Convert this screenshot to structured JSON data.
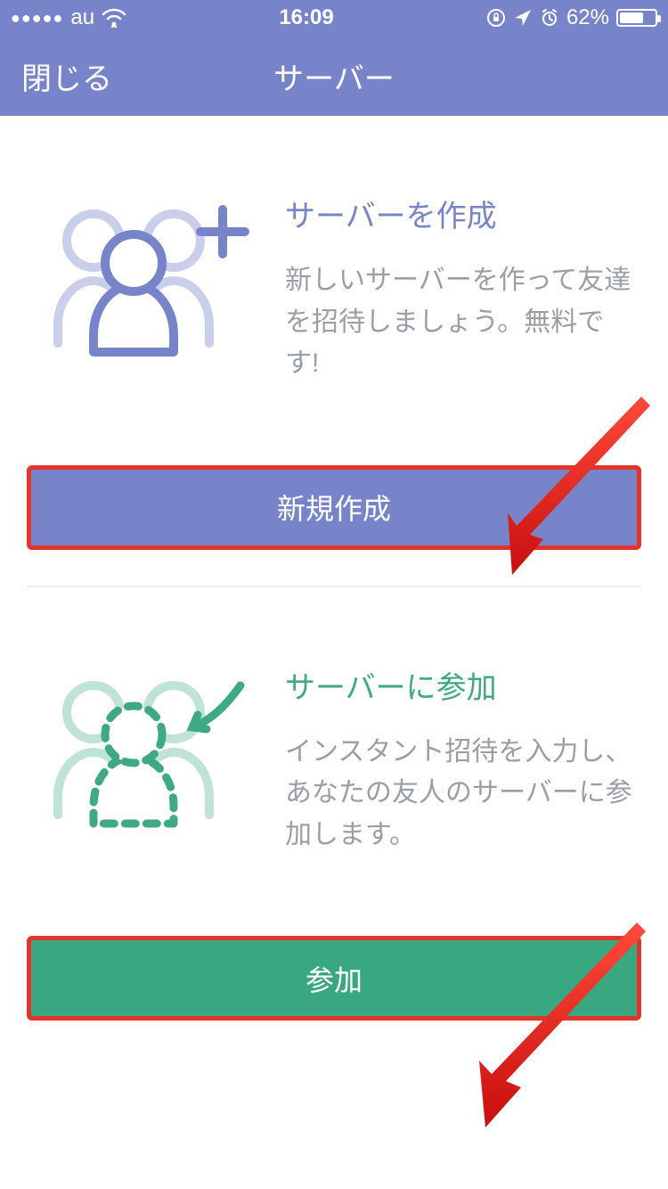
{
  "status": {
    "carrier": "au",
    "time": "16:09",
    "battery_pct": "62%"
  },
  "nav": {
    "close_label": "閉じる",
    "title": "サーバー"
  },
  "create": {
    "title": "サーバーを作成",
    "desc": "新しいサーバーを作って友達を招待しましょう。無料です!",
    "button_label": "新規作成"
  },
  "join": {
    "title": "サーバーに参加",
    "desc": "インスタント招待を入力し、あなたの友人のサーバーに参加します。",
    "button_label": "参加"
  }
}
